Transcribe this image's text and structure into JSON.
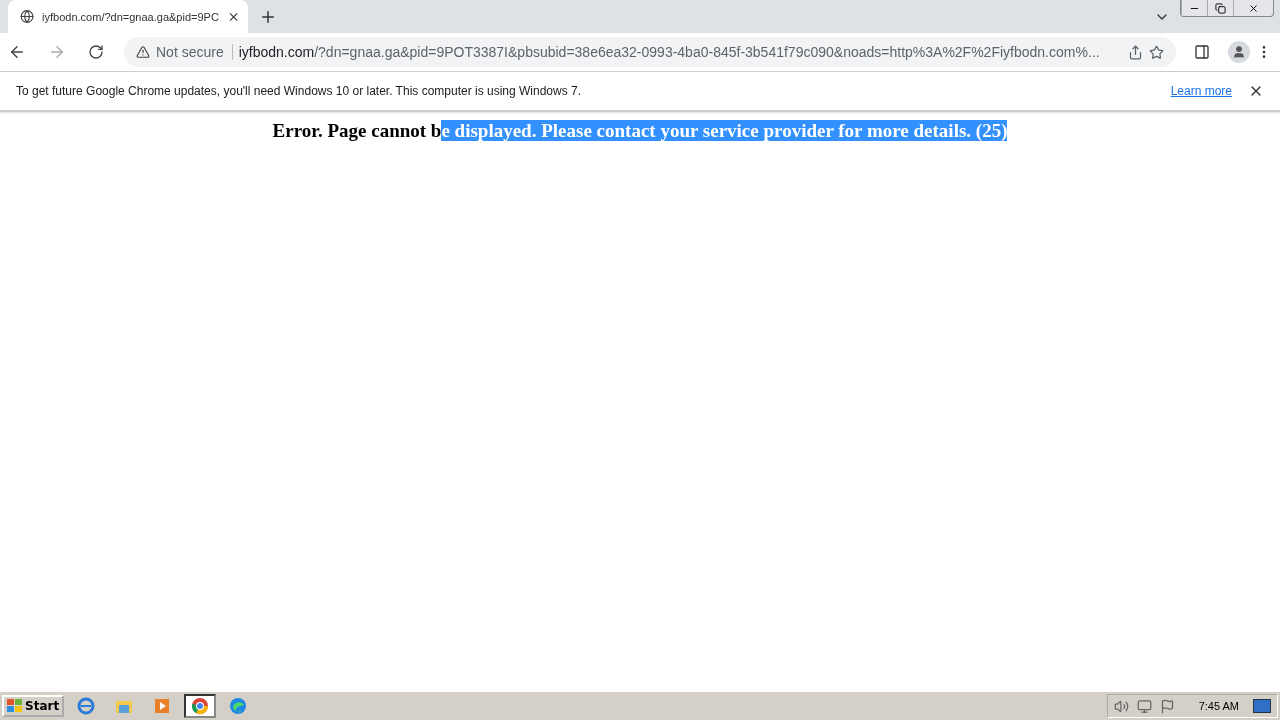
{
  "browser": {
    "tabs": [
      {
        "title": "iyfbodn.com/?dn=gnaa.ga&pid=9PC",
        "selected": true
      }
    ],
    "address_bar": {
      "security": "Not secure",
      "host": "iyfbodn.com",
      "path": "/?dn=gnaa.ga&pid=9POT3387I&pbsubid=38e6ea32-0993-4ba0-845f-3b541f79c090&noads=http%3A%2F%2Fiyfbodn.com%..."
    },
    "infobar": {
      "message": "To get future Google Chrome updates, you'll need Windows 10 or later. This computer is using Windows 7.",
      "link": "Learn more"
    }
  },
  "page": {
    "error_text": [
      {
        "text": "Error. Page cannot b",
        "selected": false
      },
      {
        "text": "e displayed. Please contact your service provider for more details. (25)",
        "selected": true
      }
    ]
  },
  "taskbar": {
    "start": "Start",
    "apps": [
      {
        "kind": "ie",
        "selected": false
      },
      {
        "kind": "folder",
        "selected": false
      },
      {
        "kind": "media",
        "selected": false
      },
      {
        "kind": "chrome",
        "selected": true
      },
      {
        "kind": "edge",
        "selected": false
      }
    ],
    "clock": "7:45 AM"
  }
}
